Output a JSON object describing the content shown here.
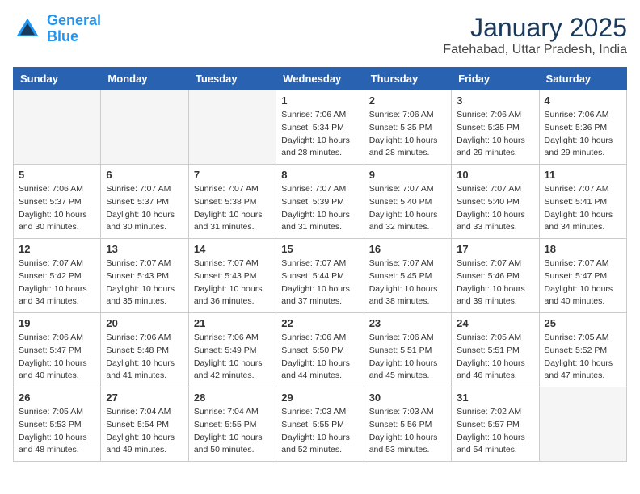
{
  "header": {
    "logo_line1": "General",
    "logo_line2": "Blue",
    "month": "January 2025",
    "location": "Fatehabad, Uttar Pradesh, India"
  },
  "days_of_week": [
    "Sunday",
    "Monday",
    "Tuesday",
    "Wednesday",
    "Thursday",
    "Friday",
    "Saturday"
  ],
  "weeks": [
    [
      {
        "day": "",
        "info": ""
      },
      {
        "day": "",
        "info": ""
      },
      {
        "day": "",
        "info": ""
      },
      {
        "day": "1",
        "info": "Sunrise: 7:06 AM\nSunset: 5:34 PM\nDaylight: 10 hours\nand 28 minutes."
      },
      {
        "day": "2",
        "info": "Sunrise: 7:06 AM\nSunset: 5:35 PM\nDaylight: 10 hours\nand 28 minutes."
      },
      {
        "day": "3",
        "info": "Sunrise: 7:06 AM\nSunset: 5:35 PM\nDaylight: 10 hours\nand 29 minutes."
      },
      {
        "day": "4",
        "info": "Sunrise: 7:06 AM\nSunset: 5:36 PM\nDaylight: 10 hours\nand 29 minutes."
      }
    ],
    [
      {
        "day": "5",
        "info": "Sunrise: 7:06 AM\nSunset: 5:37 PM\nDaylight: 10 hours\nand 30 minutes."
      },
      {
        "day": "6",
        "info": "Sunrise: 7:07 AM\nSunset: 5:37 PM\nDaylight: 10 hours\nand 30 minutes."
      },
      {
        "day": "7",
        "info": "Sunrise: 7:07 AM\nSunset: 5:38 PM\nDaylight: 10 hours\nand 31 minutes."
      },
      {
        "day": "8",
        "info": "Sunrise: 7:07 AM\nSunset: 5:39 PM\nDaylight: 10 hours\nand 31 minutes."
      },
      {
        "day": "9",
        "info": "Sunrise: 7:07 AM\nSunset: 5:40 PM\nDaylight: 10 hours\nand 32 minutes."
      },
      {
        "day": "10",
        "info": "Sunrise: 7:07 AM\nSunset: 5:40 PM\nDaylight: 10 hours\nand 33 minutes."
      },
      {
        "day": "11",
        "info": "Sunrise: 7:07 AM\nSunset: 5:41 PM\nDaylight: 10 hours\nand 34 minutes."
      }
    ],
    [
      {
        "day": "12",
        "info": "Sunrise: 7:07 AM\nSunset: 5:42 PM\nDaylight: 10 hours\nand 34 minutes."
      },
      {
        "day": "13",
        "info": "Sunrise: 7:07 AM\nSunset: 5:43 PM\nDaylight: 10 hours\nand 35 minutes."
      },
      {
        "day": "14",
        "info": "Sunrise: 7:07 AM\nSunset: 5:43 PM\nDaylight: 10 hours\nand 36 minutes."
      },
      {
        "day": "15",
        "info": "Sunrise: 7:07 AM\nSunset: 5:44 PM\nDaylight: 10 hours\nand 37 minutes."
      },
      {
        "day": "16",
        "info": "Sunrise: 7:07 AM\nSunset: 5:45 PM\nDaylight: 10 hours\nand 38 minutes."
      },
      {
        "day": "17",
        "info": "Sunrise: 7:07 AM\nSunset: 5:46 PM\nDaylight: 10 hours\nand 39 minutes."
      },
      {
        "day": "18",
        "info": "Sunrise: 7:07 AM\nSunset: 5:47 PM\nDaylight: 10 hours\nand 40 minutes."
      }
    ],
    [
      {
        "day": "19",
        "info": "Sunrise: 7:06 AM\nSunset: 5:47 PM\nDaylight: 10 hours\nand 40 minutes."
      },
      {
        "day": "20",
        "info": "Sunrise: 7:06 AM\nSunset: 5:48 PM\nDaylight: 10 hours\nand 41 minutes."
      },
      {
        "day": "21",
        "info": "Sunrise: 7:06 AM\nSunset: 5:49 PM\nDaylight: 10 hours\nand 42 minutes."
      },
      {
        "day": "22",
        "info": "Sunrise: 7:06 AM\nSunset: 5:50 PM\nDaylight: 10 hours\nand 44 minutes."
      },
      {
        "day": "23",
        "info": "Sunrise: 7:06 AM\nSunset: 5:51 PM\nDaylight: 10 hours\nand 45 minutes."
      },
      {
        "day": "24",
        "info": "Sunrise: 7:05 AM\nSunset: 5:51 PM\nDaylight: 10 hours\nand 46 minutes."
      },
      {
        "day": "25",
        "info": "Sunrise: 7:05 AM\nSunset: 5:52 PM\nDaylight: 10 hours\nand 47 minutes."
      }
    ],
    [
      {
        "day": "26",
        "info": "Sunrise: 7:05 AM\nSunset: 5:53 PM\nDaylight: 10 hours\nand 48 minutes."
      },
      {
        "day": "27",
        "info": "Sunrise: 7:04 AM\nSunset: 5:54 PM\nDaylight: 10 hours\nand 49 minutes."
      },
      {
        "day": "28",
        "info": "Sunrise: 7:04 AM\nSunset: 5:55 PM\nDaylight: 10 hours\nand 50 minutes."
      },
      {
        "day": "29",
        "info": "Sunrise: 7:03 AM\nSunset: 5:55 PM\nDaylight: 10 hours\nand 52 minutes."
      },
      {
        "day": "30",
        "info": "Sunrise: 7:03 AM\nSunset: 5:56 PM\nDaylight: 10 hours\nand 53 minutes."
      },
      {
        "day": "31",
        "info": "Sunrise: 7:02 AM\nSunset: 5:57 PM\nDaylight: 10 hours\nand 54 minutes."
      },
      {
        "day": "",
        "info": ""
      }
    ]
  ]
}
